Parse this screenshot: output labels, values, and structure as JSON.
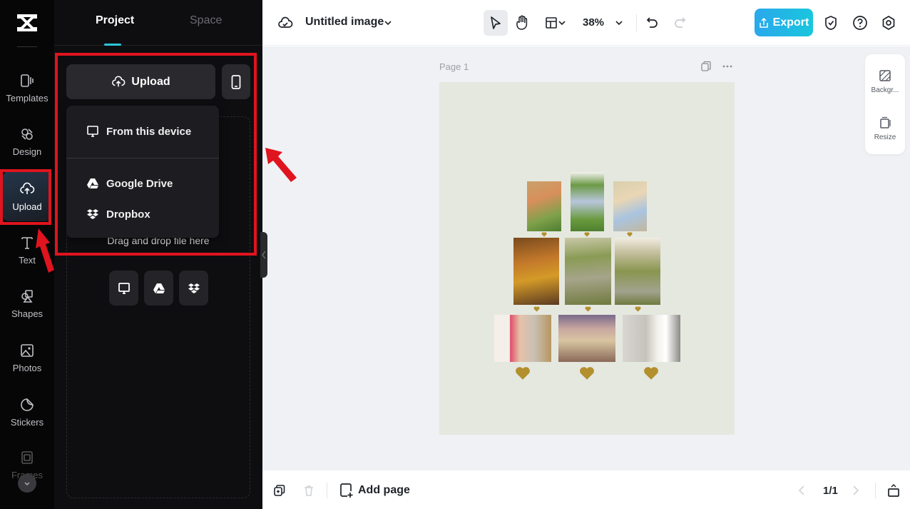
{
  "app": {
    "accent_color": "#2bc7d9",
    "annotation_color": "#e0141e"
  },
  "rail": {
    "items": [
      {
        "label": "Templates",
        "icon": "templates-icon"
      },
      {
        "label": "Design",
        "icon": "design-icon"
      },
      {
        "label": "Upload",
        "icon": "upload-cloud-icon",
        "active": true
      },
      {
        "label": "Text",
        "icon": "text-icon"
      },
      {
        "label": "Shapes",
        "icon": "shapes-icon"
      },
      {
        "label": "Photos",
        "icon": "photos-icon"
      },
      {
        "label": "Stickers",
        "icon": "stickers-icon"
      },
      {
        "label": "Frames",
        "icon": "frames-icon"
      }
    ]
  },
  "panel": {
    "tabs": [
      {
        "label": "Project",
        "active": true
      },
      {
        "label": "Space",
        "active": false
      }
    ],
    "upload_label": "Upload",
    "menu": {
      "items": [
        {
          "label": "From this device",
          "icon": "monitor-icon"
        },
        {
          "label": "Google Drive",
          "icon": "google-drive-icon"
        },
        {
          "label": "Dropbox",
          "icon": "dropbox-icon"
        }
      ]
    },
    "drag_text": "Drag and drop file here"
  },
  "topbar": {
    "title": "Untitled image",
    "zoom": "38%",
    "export_label": "Export"
  },
  "canvas": {
    "page_label": "Page 1",
    "side_tools": [
      {
        "label": "Backgr...",
        "icon": "background-icon"
      },
      {
        "label": "Resize",
        "icon": "resize-icon"
      }
    ],
    "background_color": "#e5e8df",
    "heart_color": "#b38f2e"
  },
  "bottombar": {
    "add_page_label": "Add page",
    "pager": "1/1"
  }
}
